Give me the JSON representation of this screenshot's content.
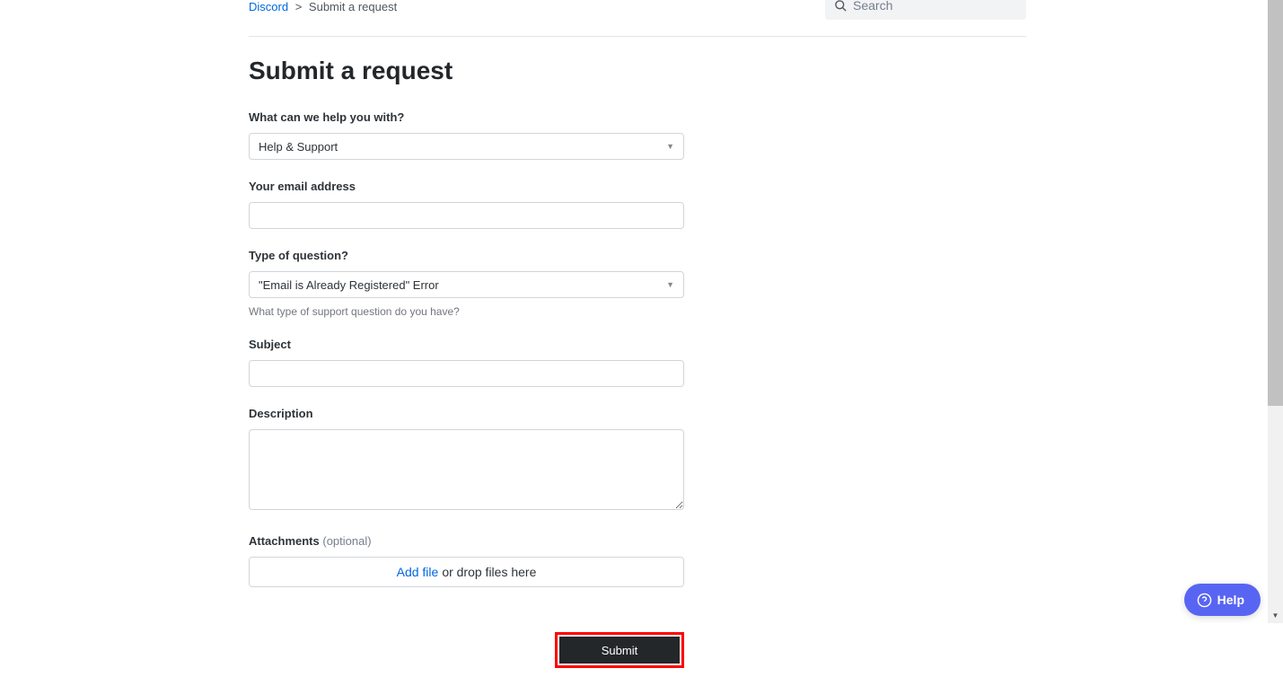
{
  "breadcrumb": {
    "root": "Discord",
    "current": "Submit a request"
  },
  "search": {
    "placeholder": "Search"
  },
  "page": {
    "title": "Submit a request"
  },
  "form": {
    "help_with": {
      "label": "What can we help you with?",
      "value": "Help & Support"
    },
    "email": {
      "label": "Your email address",
      "value": ""
    },
    "question_type": {
      "label": "Type of question?",
      "value": "\"Email is Already Registered\" Error",
      "hint": "What type of support question do you have?"
    },
    "subject": {
      "label": "Subject",
      "value": ""
    },
    "description": {
      "label": "Description",
      "value": ""
    },
    "attachments": {
      "label": "Attachments",
      "optional": "(optional)",
      "add_file": "Add file",
      "drop_text": "or drop files here"
    },
    "submit_label": "Submit"
  },
  "help_widget": {
    "label": "Help"
  }
}
